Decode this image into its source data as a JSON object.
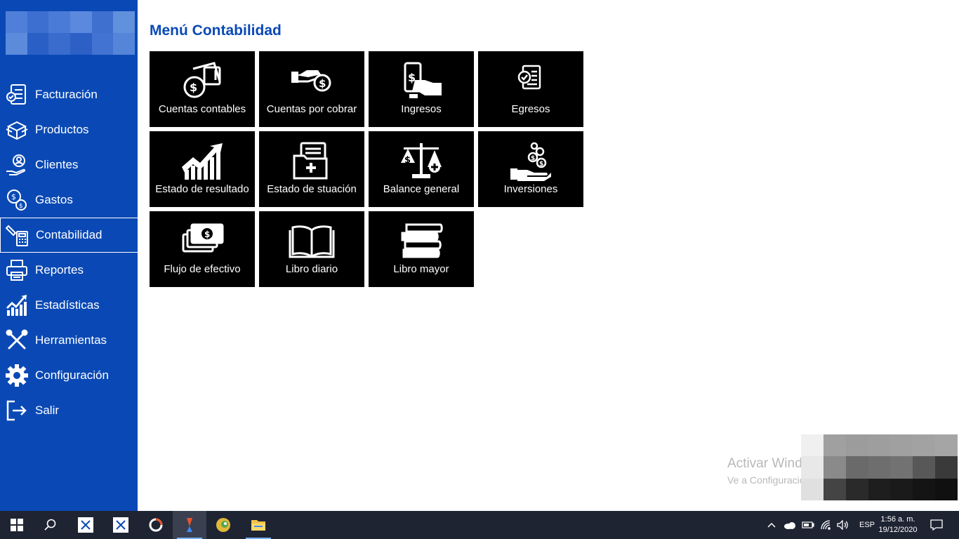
{
  "header": {
    "title": "Menú Contabilidad"
  },
  "sidebar": {
    "items": [
      {
        "label": "Facturación",
        "icon": "invoice-icon"
      },
      {
        "label": "Productos",
        "icon": "box-icon"
      },
      {
        "label": "Clientes",
        "icon": "user-hand-icon"
      },
      {
        "label": "Gastos",
        "icon": "coins-icon"
      },
      {
        "label": "Contabilidad",
        "icon": "calculator-icon",
        "active": true
      },
      {
        "label": "Reportes",
        "icon": "printer-icon"
      },
      {
        "label": "Estadísticas",
        "icon": "chart-icon"
      },
      {
        "label": "Herramientas",
        "icon": "tools-icon"
      },
      {
        "label": "Configuración",
        "icon": "gear-icon"
      },
      {
        "label": "Salir",
        "icon": "exit-icon"
      }
    ]
  },
  "tiles": [
    {
      "label": "Cuentas contables",
      "icon": "money-card-icon"
    },
    {
      "label": "Cuentas por cobrar",
      "icon": "hand-coin-icon"
    },
    {
      "label": "Ingresos",
      "icon": "phone-payment-icon"
    },
    {
      "label": "Egresos",
      "icon": "receipt-check-icon"
    },
    {
      "label": "Estado de resultado",
      "icon": "growth-chart-icon"
    },
    {
      "label": "Estado de stuación",
      "icon": "folder-plus-icon"
    },
    {
      "label": "Balance general",
      "icon": "scale-icon"
    },
    {
      "label": "Inversiones",
      "icon": "hand-coins-icon"
    },
    {
      "label": "Flujo de efectivo",
      "icon": "banknotes-icon"
    },
    {
      "label": "Libro diario",
      "icon": "open-book-icon"
    },
    {
      "label": "Libro mayor",
      "icon": "book-stack-icon"
    }
  ],
  "watermark": {
    "line1": "Activar Windows",
    "line2": "Ve a Configuración"
  },
  "taskbar": {
    "language": "ESP",
    "time": "1:56 a. m.",
    "date": "19/12/2020"
  },
  "colors": {
    "sidebar": "#0a49b5",
    "title": "#0a49b5",
    "tile": "#000000",
    "taskbar": "#1f2433"
  }
}
